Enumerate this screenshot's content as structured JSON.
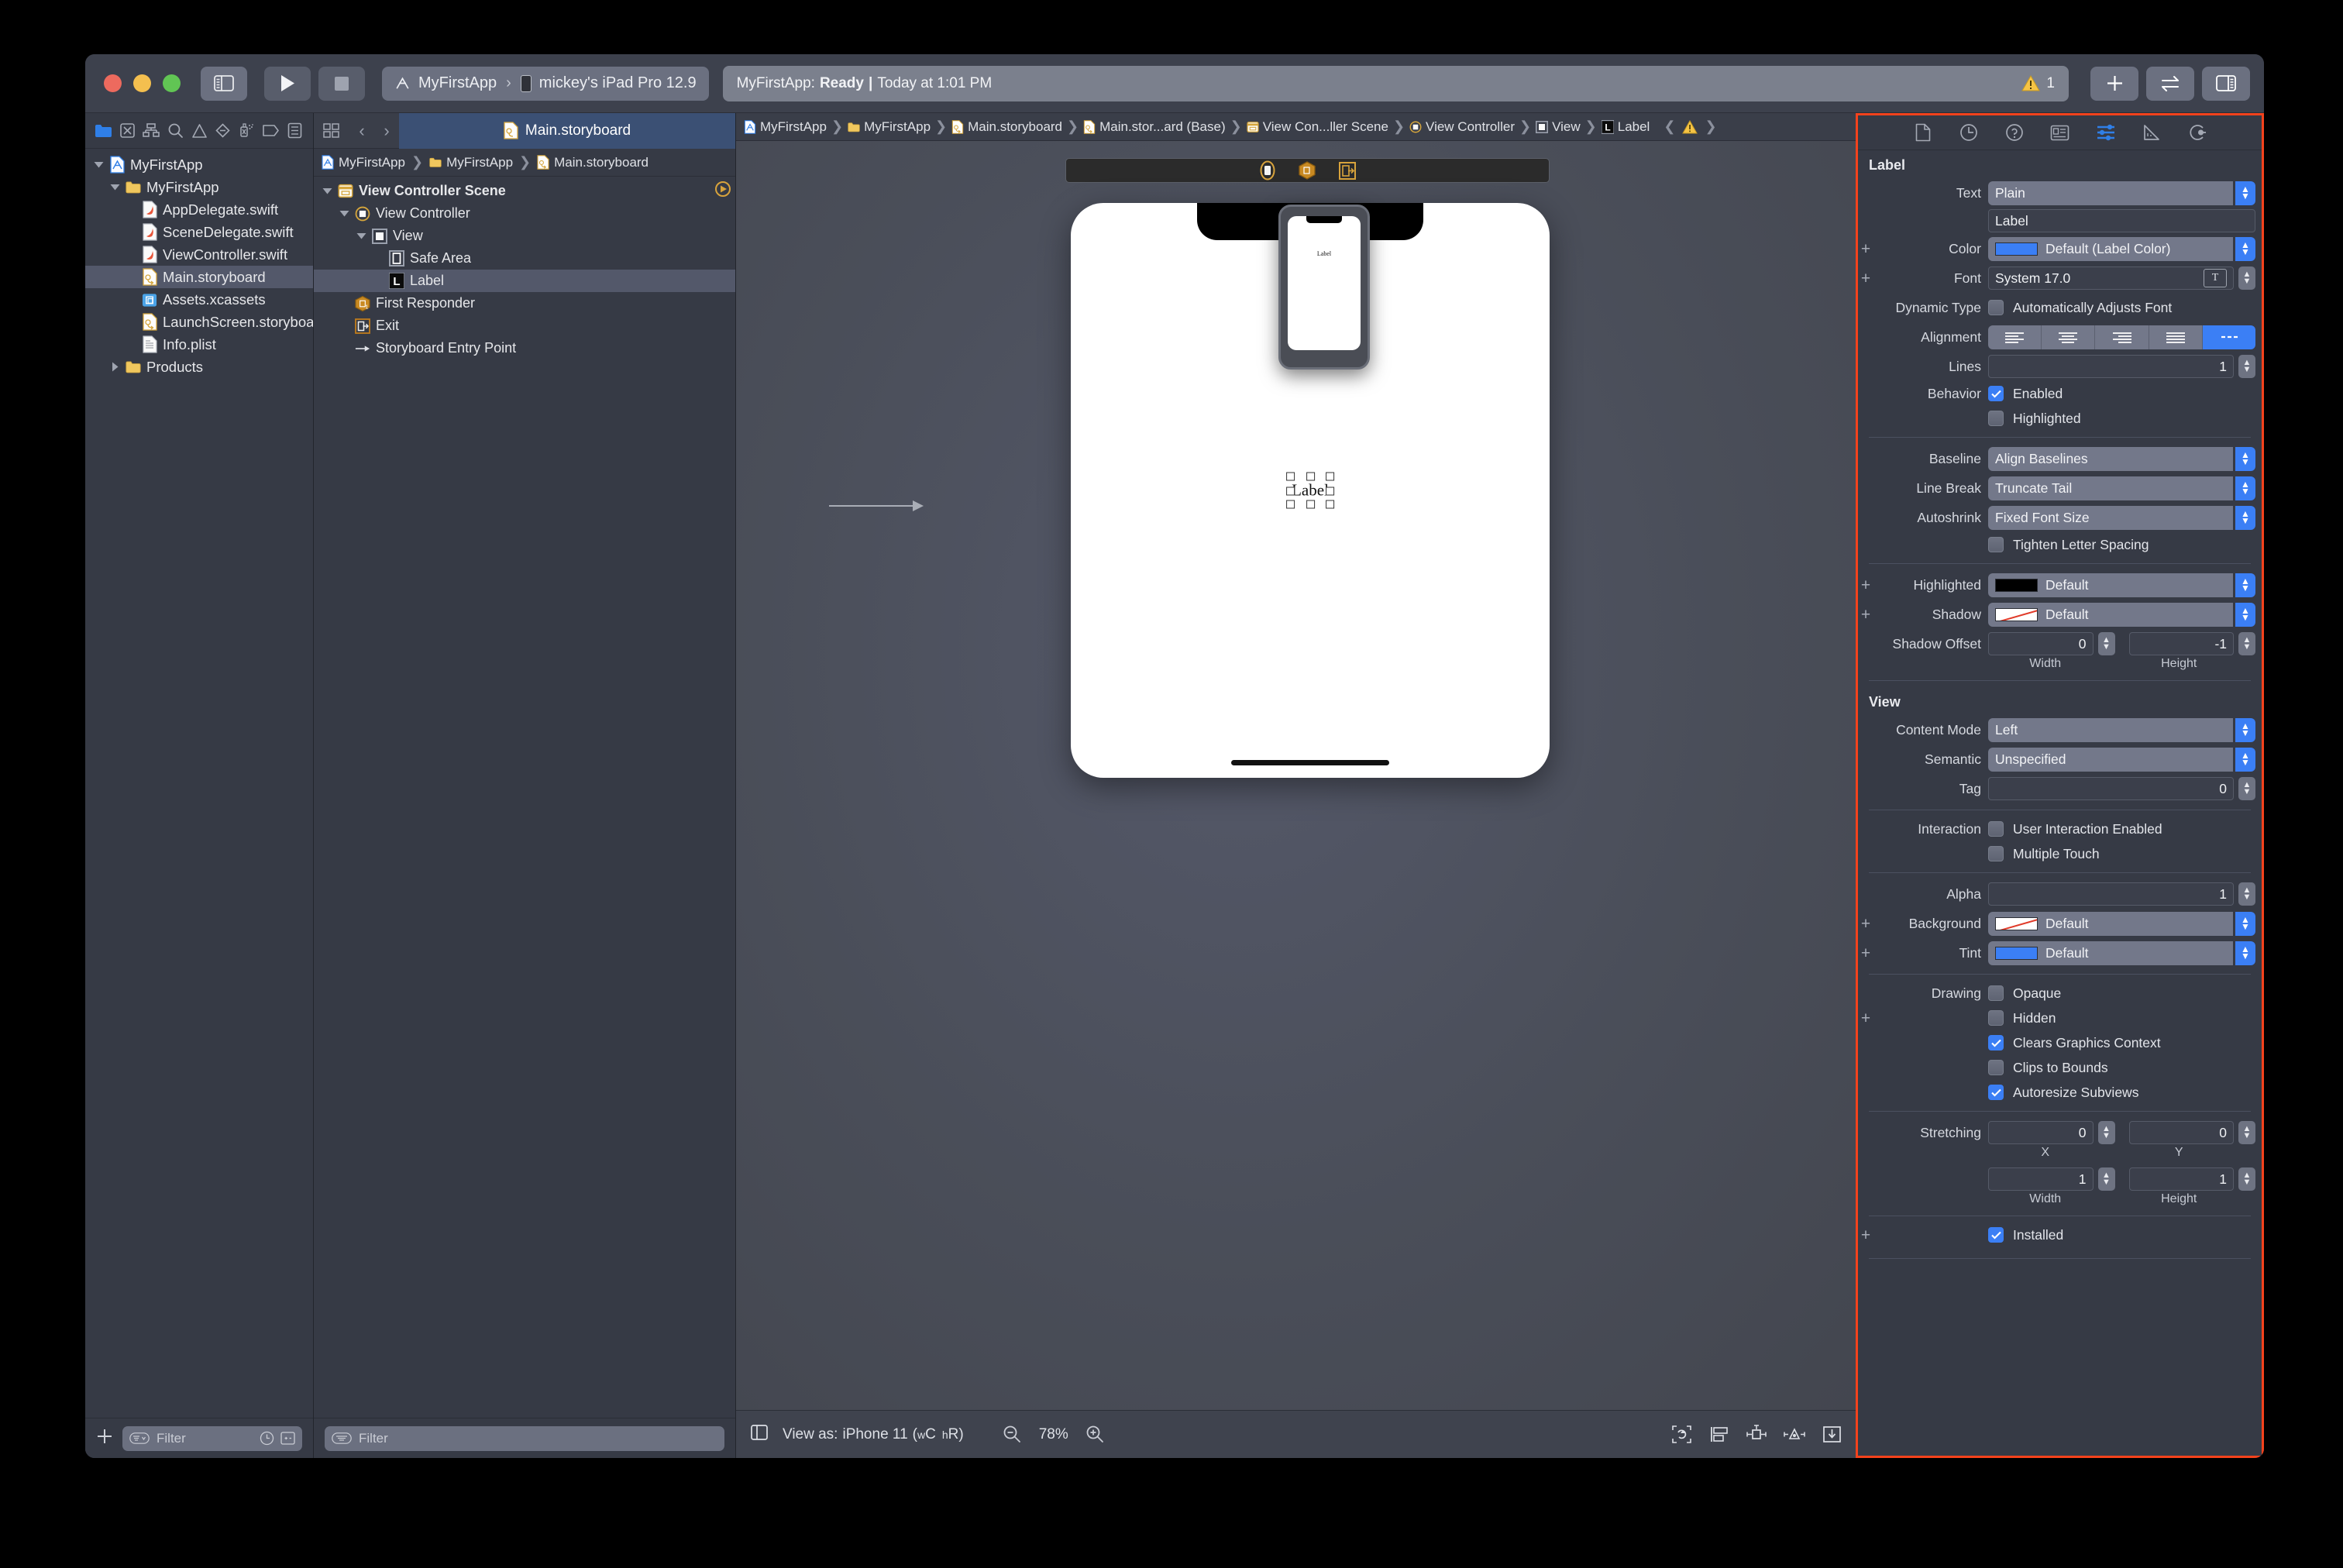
{
  "window": {
    "traffic_lights": [
      "close",
      "minimize",
      "zoom"
    ]
  },
  "toolbar": {
    "scheme_app": "MyFirstApp",
    "scheme_separator": "›",
    "scheme_device": "mickey's iPad Pro 12.9",
    "status_prefix": "MyFirstApp:",
    "status_state": "Ready",
    "status_bar_sep": "|",
    "status_time": "Today at 1:01 PM",
    "warning_count": "1"
  },
  "navigator": {
    "icons": [
      "folder-icon",
      "source-control-icon",
      "symbol-hierarchy-icon",
      "search-icon",
      "warning-icon",
      "test-icon",
      "debug-icon",
      "breakpoint-icon",
      "report-icon"
    ],
    "tree": [
      {
        "label": "MyFirstApp",
        "indent": 0,
        "icon": "project-icon",
        "twisty": "down",
        "selected": false
      },
      {
        "label": "MyFirstApp",
        "indent": 1,
        "icon": "folder-icon",
        "twisty": "down",
        "selected": false
      },
      {
        "label": "AppDelegate.swift",
        "indent": 2,
        "icon": "swift-icon",
        "twisty": "",
        "selected": false
      },
      {
        "label": "SceneDelegate.swift",
        "indent": 2,
        "icon": "swift-icon",
        "twisty": "",
        "selected": false
      },
      {
        "label": "ViewController.swift",
        "indent": 2,
        "icon": "swift-icon",
        "twisty": "",
        "selected": false
      },
      {
        "label": "Main.storyboard",
        "indent": 2,
        "icon": "storyboard-icon",
        "twisty": "",
        "selected": true
      },
      {
        "label": "Assets.xcassets",
        "indent": 2,
        "icon": "assets-icon",
        "twisty": "",
        "selected": false
      },
      {
        "label": "LaunchScreen.storyboard",
        "indent": 2,
        "icon": "storyboard-icon",
        "twisty": "",
        "selected": false
      },
      {
        "label": "Info.plist",
        "indent": 2,
        "icon": "plist-icon",
        "twisty": "",
        "selected": false
      },
      {
        "label": "Products",
        "indent": 1,
        "icon": "folder-icon",
        "twisty": "right",
        "selected": false
      }
    ],
    "add_button": "+",
    "filter_placeholder": "Filter"
  },
  "outline": {
    "tab_label": "Main.storyboard",
    "breadcrumb": [
      "MyFirstApp",
      "MyFirstApp",
      "Main.storyboard"
    ],
    "tree": [
      {
        "label": "View Controller Scene",
        "indent": 0,
        "icon": "scene-icon",
        "twisty": "down",
        "bold": true,
        "selected": false,
        "trailing": "entrypoint-arrow-icon"
      },
      {
        "label": "View Controller",
        "indent": 1,
        "icon": "view-controller-icon",
        "twisty": "down",
        "bold": false,
        "selected": false,
        "trailing": ""
      },
      {
        "label": "View",
        "indent": 2,
        "icon": "view-icon",
        "twisty": "down",
        "bold": false,
        "selected": false,
        "trailing": ""
      },
      {
        "label": "Safe Area",
        "indent": 3,
        "icon": "safe-area-icon",
        "twisty": "",
        "bold": false,
        "selected": false,
        "trailing": ""
      },
      {
        "label": "Label",
        "indent": 3,
        "icon": "label-icon",
        "twisty": "",
        "bold": false,
        "selected": true,
        "trailing": ""
      },
      {
        "label": "First Responder",
        "indent": 1,
        "icon": "first-responder-icon",
        "twisty": "",
        "bold": false,
        "selected": false,
        "trailing": ""
      },
      {
        "label": "Exit",
        "indent": 1,
        "icon": "exit-icon",
        "twisty": "",
        "bold": false,
        "selected": false,
        "trailing": ""
      },
      {
        "label": "Storyboard Entry Point",
        "indent": 1,
        "icon": "entry-point-arrow-icon",
        "twisty": "",
        "bold": false,
        "selected": false,
        "trailing": ""
      }
    ],
    "filter_placeholder": "Filter"
  },
  "canvas": {
    "jumpbar": [
      "MyFirstApp",
      "MyFirstApp",
      "Main.storyboard",
      "Main.stor...ard (Base)",
      "View Con...ller Scene",
      "View Controller",
      "View",
      "Label"
    ],
    "device_label_text": "Label",
    "mini_device_label_text": "Label",
    "bottom": {
      "view_as_prefix": "View as:",
      "view_as_device": "iPhone 11",
      "size_class_w": "w",
      "size_class_wc": "C",
      "size_class_h": "h",
      "size_class_hr": "R",
      "zoom_level": "78%"
    }
  },
  "inspector": {
    "tabs": [
      "file-inspector-icon",
      "history-inspector-icon",
      "quick-help-icon",
      "identity-inspector-icon",
      "attributes-inspector-icon",
      "size-inspector-icon",
      "connections-inspector-icon"
    ],
    "active_tab_index": 4,
    "label_section": {
      "title": "Label",
      "text_label": "Text",
      "text_value": "Plain",
      "text_content": "Label",
      "color_label": "Color",
      "color_value": "Default (Label Color)",
      "color_swatch": "#3b7ff5",
      "font_label": "Font",
      "font_value": "System 17.0",
      "dynamic_type_label": "Dynamic Type",
      "dynamic_type_checkbox": "Automatically Adjusts Font",
      "dynamic_type_checked": false,
      "alignment_label": "Alignment",
      "alignment_options": [
        "align-left",
        "align-center",
        "align-right",
        "align-justified",
        "align-natural"
      ],
      "alignment_selected": 4,
      "lines_label": "Lines",
      "lines_value": "1",
      "behavior_label": "Behavior",
      "behavior_enabled_label": "Enabled",
      "behavior_enabled_checked": true,
      "behavior_highlighted_label": "Highlighted",
      "behavior_highlighted_checked": false,
      "baseline_label": "Baseline",
      "baseline_value": "Align Baselines",
      "line_break_label": "Line Break",
      "line_break_value": "Truncate Tail",
      "autoshrink_label": "Autoshrink",
      "autoshrink_value": "Fixed Font Size",
      "tighten_label": "Tighten Letter Spacing",
      "tighten_checked": false,
      "highlighted_label": "Highlighted",
      "highlighted_value": "Default",
      "highlighted_swatch": "#000000",
      "shadow_label": "Shadow",
      "shadow_value": "Default",
      "shadow_offset_label": "Shadow Offset",
      "shadow_offset_width": "0",
      "shadow_offset_height": "-1",
      "width_sublabel": "Width",
      "height_sublabel": "Height"
    },
    "view_section": {
      "title": "View",
      "content_mode_label": "Content Mode",
      "content_mode_value": "Left",
      "semantic_label": "Semantic",
      "semantic_value": "Unspecified",
      "tag_label": "Tag",
      "tag_value": "0",
      "interaction_label": "Interaction",
      "user_interaction_label": "User Interaction Enabled",
      "user_interaction_checked": false,
      "multiple_touch_label": "Multiple Touch",
      "multiple_touch_checked": false,
      "alpha_label": "Alpha",
      "alpha_value": "1",
      "background_label": "Background",
      "background_value": "Default",
      "tint_label": "Tint",
      "tint_value": "Default",
      "tint_swatch": "#3b7ff5",
      "drawing_label": "Drawing",
      "opaque_label": "Opaque",
      "opaque_checked": false,
      "hidden_label": "Hidden",
      "hidden_checked": false,
      "clears_graphics_label": "Clears Graphics Context",
      "clears_graphics_checked": true,
      "clips_bounds_label": "Clips to Bounds",
      "clips_bounds_checked": false,
      "autoresize_label": "Autoresize Subviews",
      "autoresize_checked": true,
      "stretching_label": "Stretching",
      "stretching_x": "0",
      "stretching_y": "0",
      "stretching_width": "1",
      "stretching_height": "1",
      "x_sublabel": "X",
      "y_sublabel": "Y",
      "width_sublabel": "Width",
      "height_sublabel": "Height",
      "installed_label": "Installed",
      "installed_checked": true
    }
  },
  "colors": {
    "accent_blue": "#3b7ff5",
    "inspector_border": "#f4421c",
    "selection": "#53586a",
    "tab_active": "#3b5074"
  }
}
